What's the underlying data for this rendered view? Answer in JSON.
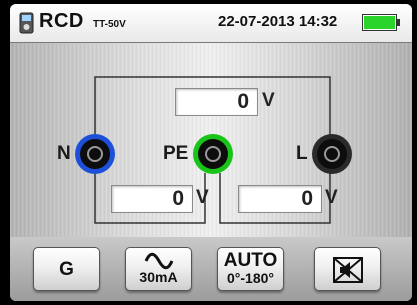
{
  "header": {
    "mode": "RCD",
    "system": "TT-50V",
    "datetime": "22-07-2013 14:32",
    "battery_color": "#2bd42b"
  },
  "measurements": {
    "top_value": "0",
    "top_unit": "V",
    "left_value": "0",
    "left_unit": "V",
    "right_value": "0",
    "right_unit": "V"
  },
  "terminals": {
    "n_label": "N",
    "pe_label": "PE",
    "l_label": "L",
    "n_color": "#1e4fd8",
    "pe_color": "#19c419",
    "l_color": "#2a2a2a"
  },
  "buttons": {
    "g_label": "G",
    "ac_icon": "sine-wave-icon",
    "current_label": "30mA",
    "auto_label": "AUTO",
    "phase_label": "0°-180°",
    "mute_icon": "sound-off-icon"
  }
}
